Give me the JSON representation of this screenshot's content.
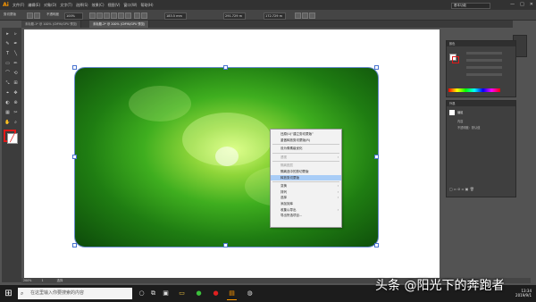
{
  "app": {
    "logo": "Ai",
    "workspace": "基本功能"
  },
  "menubar": {
    "items": [
      "文件(F)",
      "编辑(E)",
      "对象(O)",
      "文字(T)",
      "选择(S)",
      "效果(C)",
      "视图(V)",
      "窗口(W)",
      "帮助(H)"
    ],
    "window_controls": [
      "—",
      "□",
      "✕"
    ]
  },
  "optbar": {
    "label_left": "剪切蒙版",
    "opacity_label": "不透明度",
    "opacity": "100%",
    "x": "183.5 mm",
    "w": "291.729 m",
    "h": "172.729 m"
  },
  "tabs": [
    {
      "label": "未标题-1* @ 100% (CMYK/GPU 预览)",
      "active": false
    },
    {
      "label": "未标题-2* @ 200% (CMYK/GPU 预览)",
      "active": true
    }
  ],
  "context_menu": {
    "items": [
      {
        "label": "还原(U)“建立剪切蒙版”",
        "disabled": false,
        "submenu": false
      },
      {
        "label": "重做释放剪切蒙版(R)",
        "disabled": false,
        "submenu": false
      },
      {
        "sep": true
      },
      {
        "label": "设为像素级优化",
        "disabled": false,
        "submenu": false
      },
      {
        "sep": true
      },
      {
        "label": "透视",
        "disabled": true,
        "submenu": true
      },
      {
        "sep": true
      },
      {
        "label": "隔离图层",
        "disabled": true,
        "submenu": false
      },
      {
        "label": "隔离选中的剪切蒙版",
        "disabled": false,
        "submenu": false
      },
      {
        "label": "释放剪切蒙版",
        "disabled": false,
        "submenu": false,
        "highlight": true
      },
      {
        "sep": true
      },
      {
        "label": "变换",
        "disabled": false,
        "submenu": true
      },
      {
        "label": "排列",
        "disabled": false,
        "submenu": true
      },
      {
        "label": "选择",
        "disabled": false,
        "submenu": true
      },
      {
        "label": "添加到库",
        "disabled": false,
        "submenu": false
      },
      {
        "label": "收集以导出",
        "disabled": false,
        "submenu": true
      },
      {
        "label": "导出所选项目...",
        "disabled": false,
        "submenu": false
      }
    ]
  },
  "panels": {
    "color_title": "颜色",
    "appearance_title": "外观",
    "appearance_item": "编组",
    "appearance_sub1": "内容",
    "appearance_sub2": "不透明度：默认值"
  },
  "status": {
    "zoom": "200%",
    "page": "1",
    "tool": "选择"
  },
  "taskbar": {
    "search_placeholder": "在这里输入你要搜索的内容",
    "time": "13:34",
    "date": "2019/9/1"
  },
  "watermark": "头条 @阳光下的奔跑者",
  "colors": {
    "accent_orange": "#ff9a00",
    "highlight": "#a9cdf7",
    "none_red": "#e01818"
  }
}
